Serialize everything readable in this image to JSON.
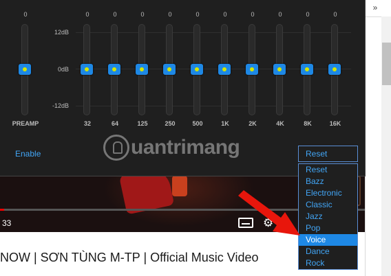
{
  "browser": {
    "chevron": "»"
  },
  "equalizer": {
    "db_labels": [
      "12dB",
      "0dB",
      "-12dB"
    ],
    "preamp": {
      "label": "PREAMP",
      "value": "0"
    },
    "bands": [
      {
        "label": "32",
        "value": "0"
      },
      {
        "label": "64",
        "value": "0"
      },
      {
        "label": "125",
        "value": "0"
      },
      {
        "label": "250",
        "value": "0"
      },
      {
        "label": "500",
        "value": "0"
      },
      {
        "label": "1K",
        "value": "0"
      },
      {
        "label": "2K",
        "value": "0"
      },
      {
        "label": "4K",
        "value": "0"
      },
      {
        "label": "8K",
        "value": "0"
      },
      {
        "label": "16K",
        "value": "0"
      }
    ],
    "enable_label": "Enable",
    "preset": {
      "selected_value": "Reset",
      "options": [
        "Reset",
        "Bazz",
        "Electronic",
        "Classic",
        "Jazz",
        "Pop",
        "Voice",
        "Dance",
        "Rock"
      ],
      "highlighted": "Voice"
    }
  },
  "watermark": {
    "text": "uantrimang"
  },
  "video": {
    "time": "33",
    "title": "NOW | SƠN TÙNG M-TP | Official Music Video"
  },
  "colors": {
    "accent": "#1e88e5",
    "link": "#42a5f5",
    "panel": "#1f1f1f",
    "arrow": "#e8160c"
  }
}
